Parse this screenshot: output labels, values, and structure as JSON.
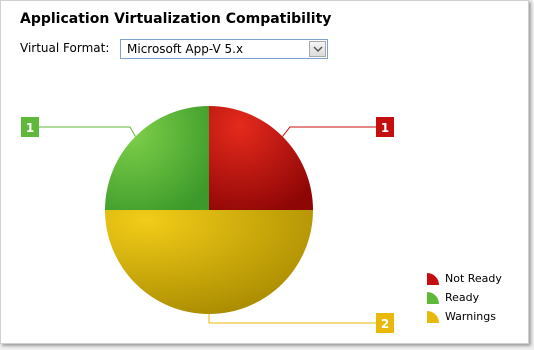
{
  "header": {
    "title": "Application Virtualization Compatibility"
  },
  "format": {
    "label": "Virtual Format:",
    "selected": "Microsoft App-V 5.x"
  },
  "colors": {
    "not_ready": "#c50e0e",
    "ready": "#5fb83a",
    "warnings": "#e8b90a"
  },
  "chart_data": {
    "type": "pie",
    "categories": [
      "Not Ready",
      "Ready",
      "Warnings"
    ],
    "values": [
      1,
      1,
      2
    ],
    "legend_position": "bottom-right"
  },
  "legend": {
    "items": [
      {
        "label": "Not Ready"
      },
      {
        "label": "Ready"
      },
      {
        "label": "Warnings"
      }
    ]
  }
}
